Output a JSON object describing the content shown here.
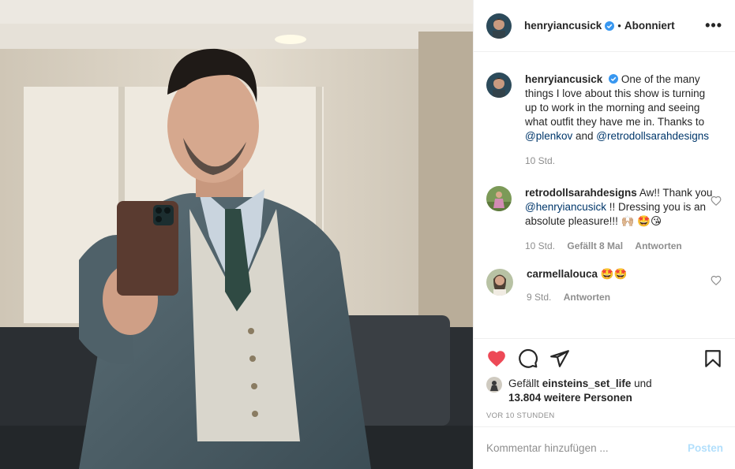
{
  "post": {
    "author": "henryiancusick",
    "follow_status": "Abonniert",
    "dot": "•",
    "more": "•••"
  },
  "caption": {
    "username": "henryiancusick",
    "text_before": "One of the many things I love about this show is turning up to work in the morning and seeing what outfit they have me in. Thanks to ",
    "mention1": "@plenkov",
    "and": " and ",
    "mention2": "@retrodollsarahdesigns",
    "time": "10 Std."
  },
  "comments": [
    {
      "username": "retrodollsarahdesigns",
      "text_before": "Aw!! Thank you ",
      "mention": "@henryiancusick",
      "text_after": " !! Dressing you is an absolute pleasure!!! 🙌🏼 🤩😘",
      "time": "10 Std.",
      "likes": "Gefällt 8 Mal",
      "reply": "Antworten"
    },
    {
      "username": "carmellalouca",
      "text": "🤩🤩",
      "time": "9 Std.",
      "reply": "Antworten"
    }
  ],
  "likes": {
    "prefix": "Gefällt ",
    "user": "einsteins_set_life",
    "suffix": " und",
    "count": "13.804 weitere Personen"
  },
  "timestamp": "VOR 10 STUNDEN",
  "add_comment": {
    "placeholder": "Kommentar hinzufügen ...",
    "post_label": "Posten"
  },
  "icons": [
    "heart-icon",
    "comment-icon",
    "share-icon",
    "bookmark-icon",
    "verified-icon"
  ],
  "colors": {
    "like_red": "#ed4956",
    "link_blue": "#00376b",
    "post_disabled": "#b2dffc",
    "verified": "#3897f0"
  }
}
